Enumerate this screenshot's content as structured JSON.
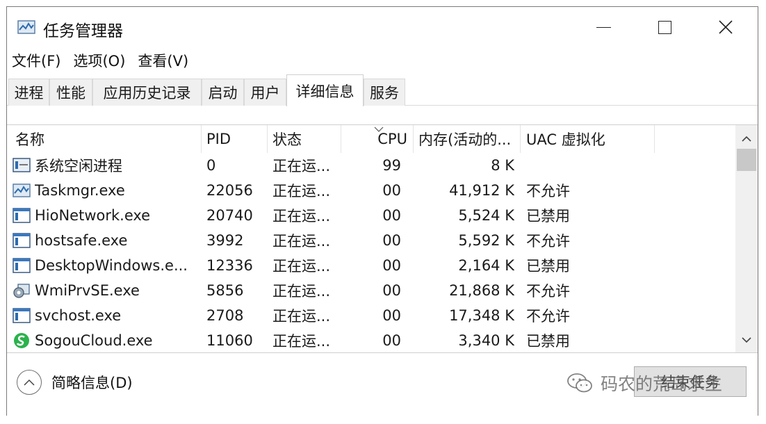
{
  "window": {
    "title": "任务管理器"
  },
  "menu": [
    "文件(F)",
    "选项(O)",
    "查看(V)"
  ],
  "tabs": [
    {
      "label": "进程"
    },
    {
      "label": "性能"
    },
    {
      "label": "应用历史记录"
    },
    {
      "label": "启动"
    },
    {
      "label": "用户"
    },
    {
      "label": "详细信息",
      "active": true
    },
    {
      "label": "服务"
    }
  ],
  "columns": [
    "名称",
    "PID",
    "状态",
    "CPU",
    "内存(活动的...",
    "UAC 虚拟化"
  ],
  "rows": [
    {
      "name": "系统空闲进程",
      "pid": "0",
      "status": "正在运...",
      "cpu": "99",
      "mem": "8 K",
      "uac": "",
      "icon": "system-idle-icon"
    },
    {
      "name": "Taskmgr.exe",
      "pid": "22056",
      "status": "正在运...",
      "cpu": "00",
      "mem": "41,912 K",
      "uac": "不允许",
      "icon": "task-manager-icon"
    },
    {
      "name": "HioNetwork.exe",
      "pid": "20740",
      "status": "正在运...",
      "cpu": "00",
      "mem": "5,524 K",
      "uac": "已禁用",
      "icon": "app-window-icon"
    },
    {
      "name": "hostsafe.exe",
      "pid": "3992",
      "status": "正在运...",
      "cpu": "00",
      "mem": "5,592 K",
      "uac": "不允许",
      "icon": "app-window-icon"
    },
    {
      "name": "DesktopWindows.e...",
      "pid": "12336",
      "status": "正在运...",
      "cpu": "00",
      "mem": "2,164 K",
      "uac": "已禁用",
      "icon": "app-window-icon"
    },
    {
      "name": "WmiPrvSE.exe",
      "pid": "5856",
      "status": "正在运...",
      "cpu": "00",
      "mem": "21,868 K",
      "uac": "不允许",
      "icon": "wmi-gear-icon"
    },
    {
      "name": "svchost.exe",
      "pid": "2708",
      "status": "正在运...",
      "cpu": "00",
      "mem": "17,348 K",
      "uac": "不允许",
      "icon": "app-window-icon"
    },
    {
      "name": "SogouCloud.exe",
      "pid": "11060",
      "status": "正在运...",
      "cpu": "00",
      "mem": "3,340 K",
      "uac": "已禁用",
      "icon": "sogou-icon"
    }
  ],
  "footer": {
    "fewer_details": "简略信息(D)",
    "end_task": "结束任务",
    "watermark": "码农的荒岛求生"
  },
  "colors": {
    "accent": "#0067c0",
    "sogou_green": "#2bb24c",
    "window_border": "#7a7a7a"
  }
}
